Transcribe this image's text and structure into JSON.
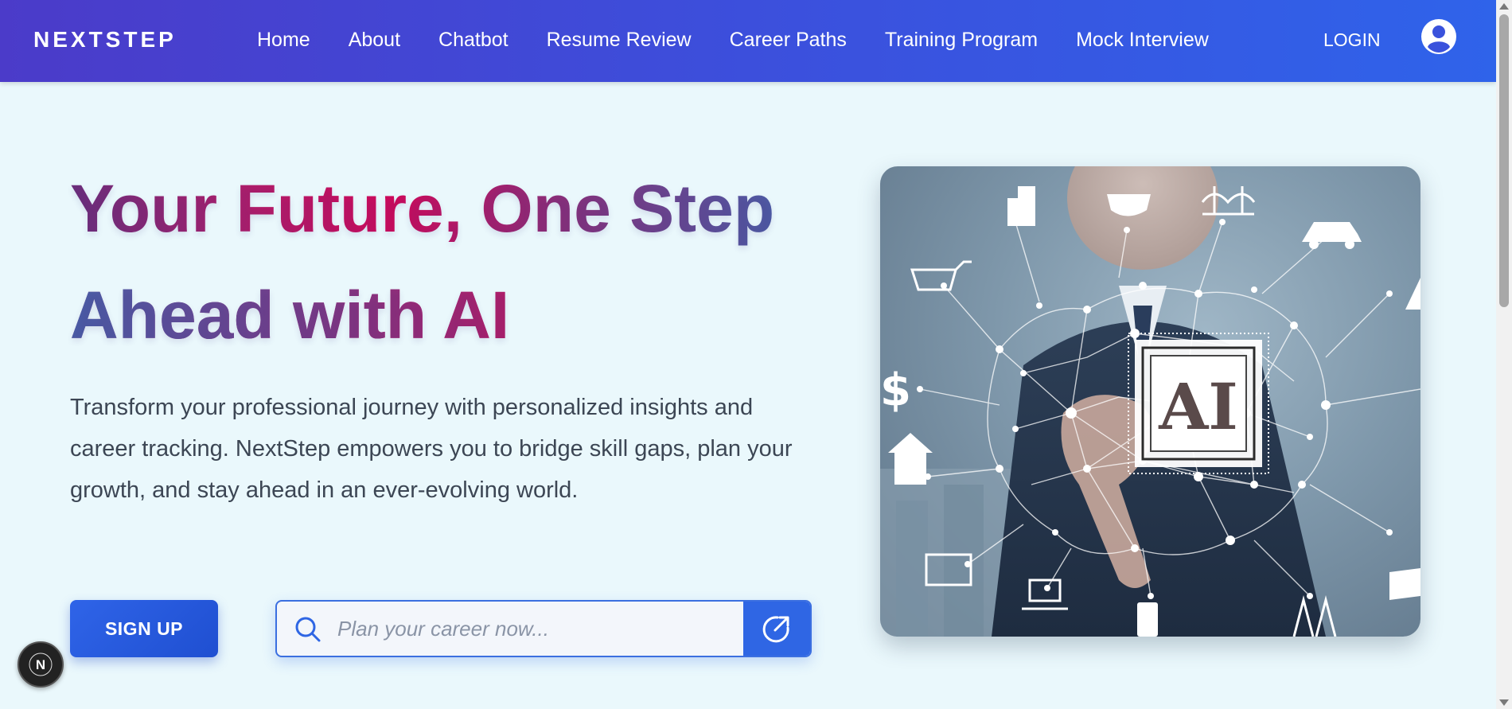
{
  "navbar": {
    "brand": "NEXTSTEP",
    "links": [
      {
        "label": "Home"
      },
      {
        "label": "About"
      },
      {
        "label": "Chatbot"
      },
      {
        "label": "Resume Review"
      },
      {
        "label": "Career Paths"
      },
      {
        "label": "Training Program"
      },
      {
        "label": "Mock Interview"
      }
    ],
    "login_label": "LOGIN",
    "avatar_icon": "user-circle-icon"
  },
  "hero": {
    "headline_line1": "Your Future, One Step",
    "headline_line2": "Ahead with AI",
    "description": "Transform your professional journey with personalized insights and career tracking. NextStep empowers you to bridge skill gaps, plan your growth, and stay ahead in an ever-evolving world.",
    "signup_label": "SIGN UP",
    "search": {
      "placeholder": "Plan your career now...",
      "icon": "search-icon",
      "action_icon": "external-link-icon"
    },
    "image": {
      "chip_text": "AI",
      "icons": [
        "building-icon",
        "camera-icon",
        "bridge-icon",
        "car-icon",
        "cart-icon",
        "road-icon",
        "dollar-icon",
        "home-icon",
        "monitor-icon",
        "laptop-icon",
        "phone-icon",
        "tower-icon",
        "solar-panel-icon"
      ]
    }
  },
  "floating_badge": {
    "label": "N"
  },
  "colors": {
    "nav_start": "#4b3bc9",
    "nav_end": "#2f63ea",
    "page_bg": "#eaf8fc",
    "accent": "#2f64e8",
    "headline_pink": "#d1095a",
    "headline_purple": "#6b2f7c"
  }
}
